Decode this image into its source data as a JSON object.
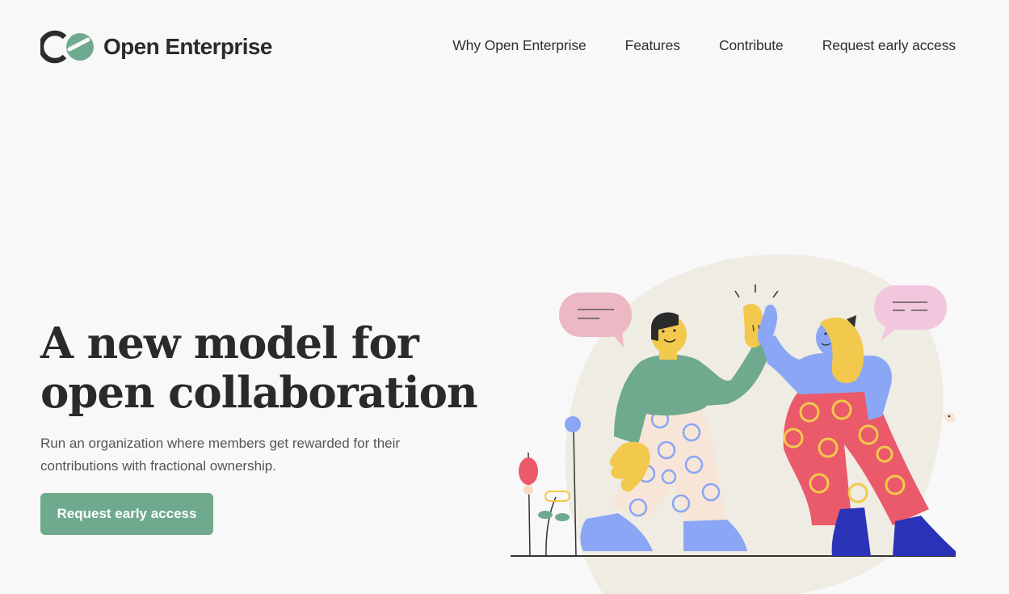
{
  "brand": {
    "name": "Open Enterprise",
    "accent": "#6fa98e",
    "dark": "#2b2b2b"
  },
  "nav": {
    "items": [
      {
        "label": "Why Open Enterprise"
      },
      {
        "label": "Features"
      },
      {
        "label": "Contribute"
      },
      {
        "label": "Request early access"
      }
    ]
  },
  "hero": {
    "title_line1": "A new model for",
    "title_line2": "open collaboration",
    "subtitle": "Run an organization where members get rewarded for their contributions with fractional ownership.",
    "cta_label": "Request early access"
  },
  "illustration": {
    "icon": "high-five-illustration",
    "colors": {
      "backdrop": "#efece4",
      "green": "#6fa98e",
      "yellow": "#f2c94c",
      "blue": "#8aa6f5",
      "red": "#ea5a6a",
      "pink_bubble": "#ebb8c4",
      "navy": "#2a32b8",
      "cream": "#f7e6d8"
    }
  }
}
